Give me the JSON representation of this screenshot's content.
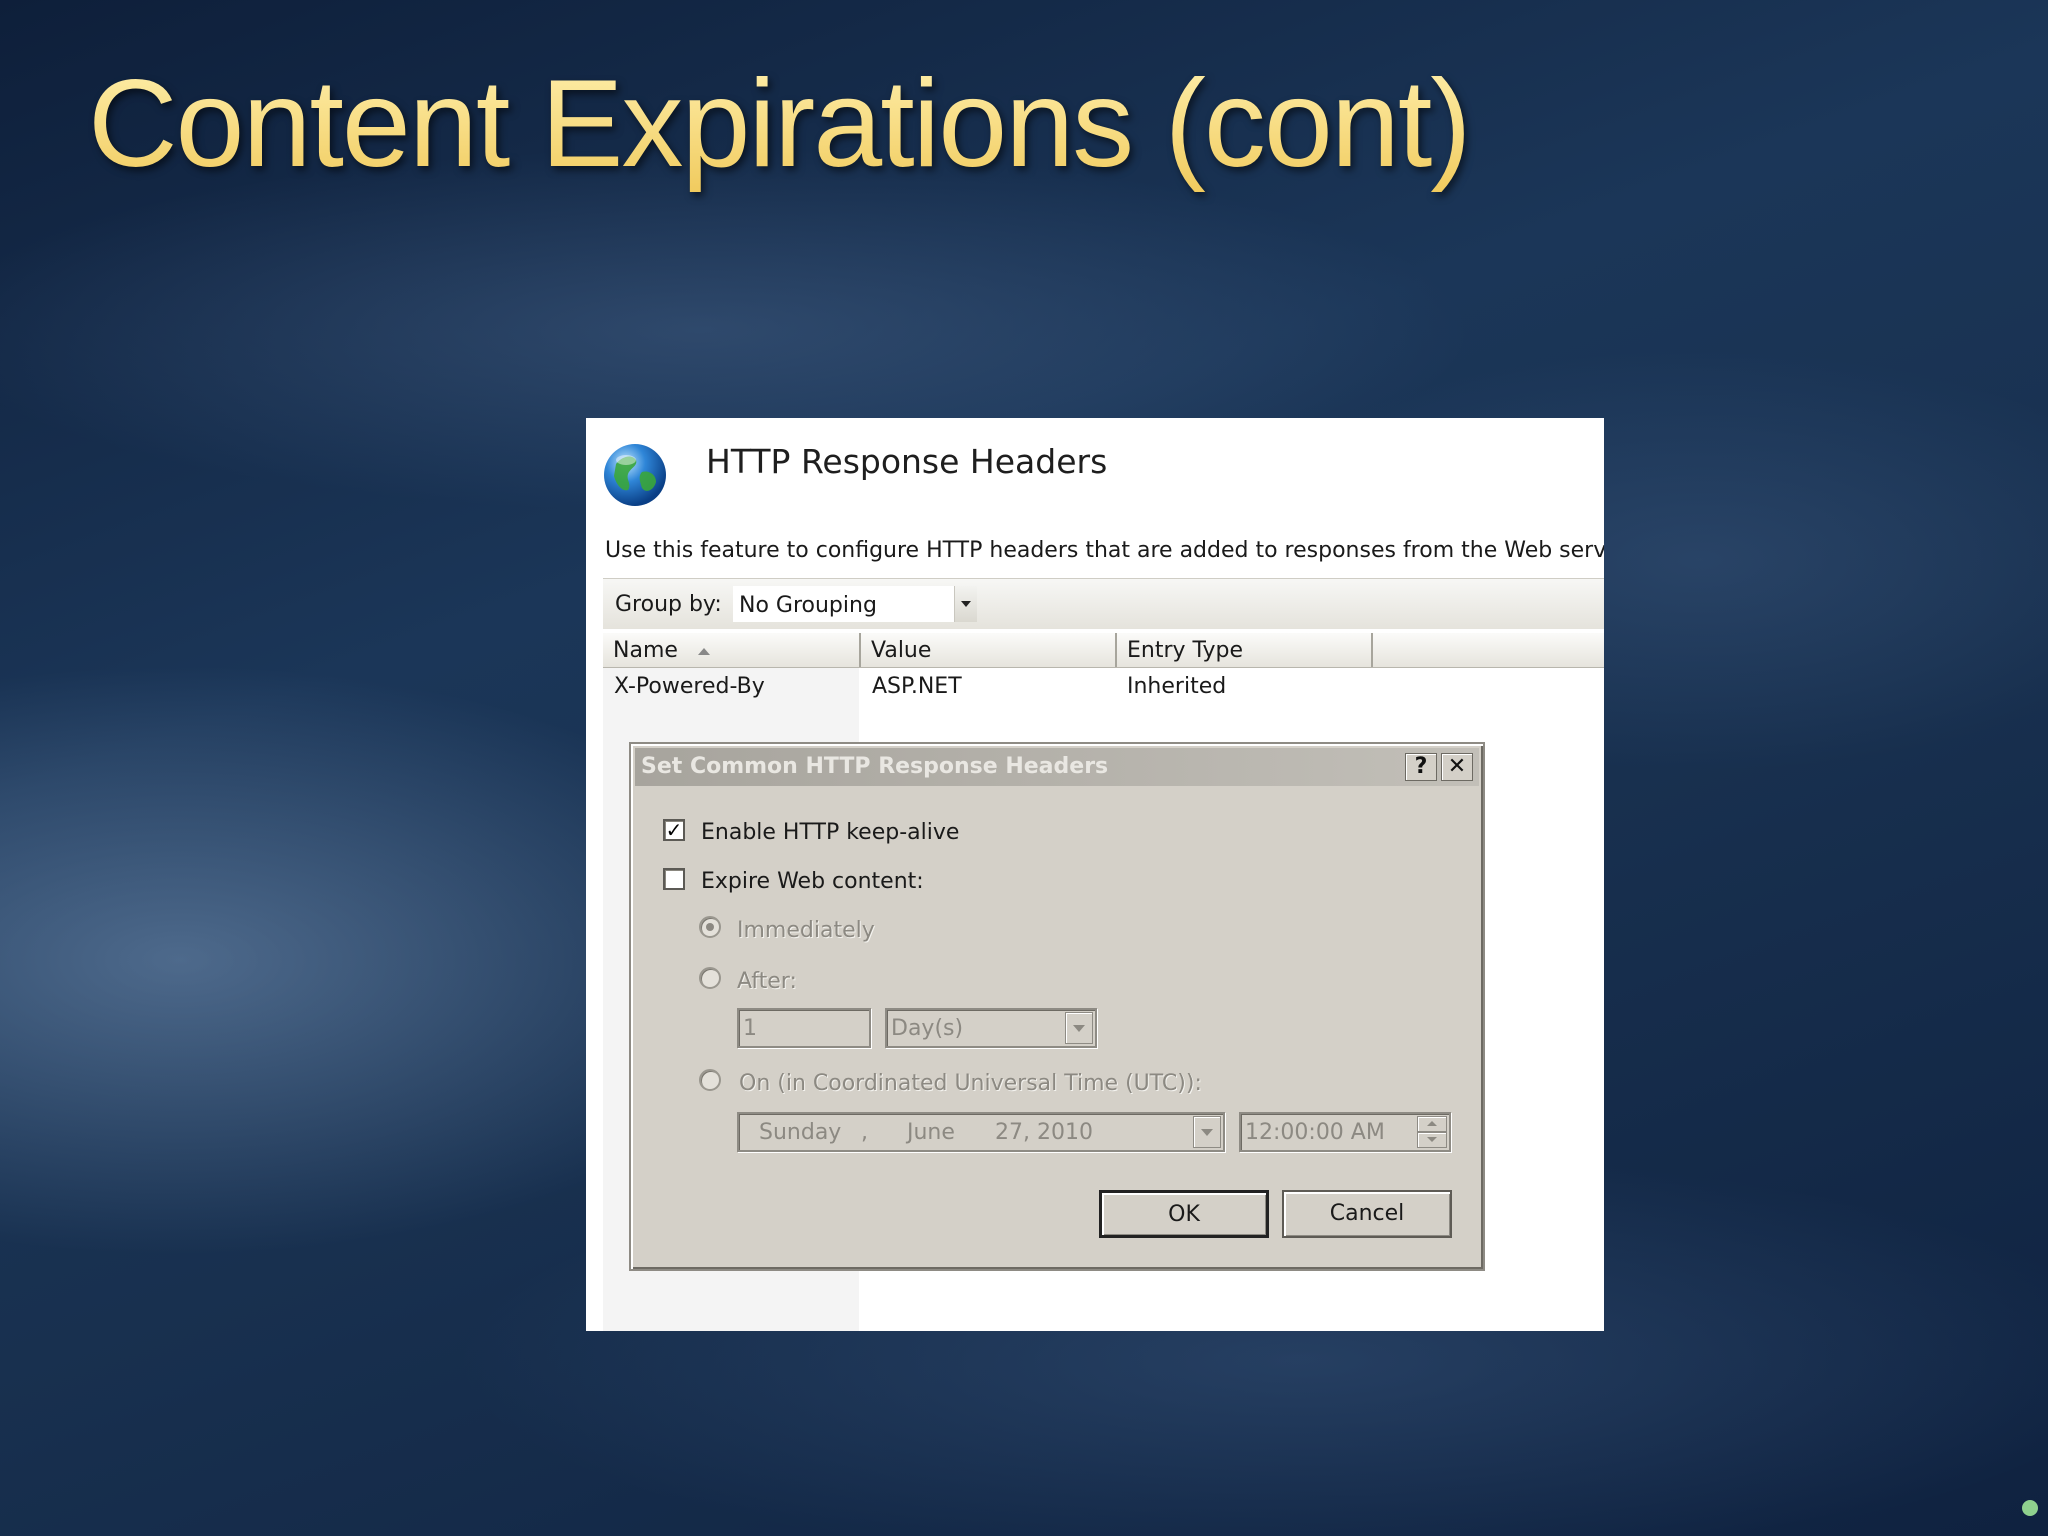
{
  "slide": {
    "title": "Content Expirations (cont)"
  },
  "panel": {
    "title": "HTTP Response Headers",
    "description": "Use this feature to configure HTTP headers that are added to responses from the Web server.",
    "group_by_label": "Group by:",
    "group_by_value": "No Grouping",
    "columns": [
      "Name",
      "Value",
      "Entry Type",
      ""
    ],
    "rows": [
      {
        "name": "X-Powered-By",
        "value": "ASP.NET",
        "entry_type": "Inherited"
      }
    ]
  },
  "dialog": {
    "title": "Set Common HTTP Response Headers",
    "help_button": "?",
    "close_button": "✕",
    "keep_alive_label": "Enable HTTP keep-alive",
    "keep_alive_checked": true,
    "expire_label": "Expire Web content:",
    "expire_checked": false,
    "immediately_label": "Immediately",
    "after_label": "After:",
    "after_value": "1",
    "after_unit": "Day(s)",
    "on_label": "On (in Coordinated Universal Time (UTC)):",
    "date_day": "Sunday",
    "date_sep": ",",
    "date_month": "June",
    "date_rest": "27, 2010",
    "time_value": "12:00:00 AM",
    "ok_label": "OK",
    "cancel_label": "Cancel"
  },
  "colors": {
    "title_gold": "#f3d977",
    "dialog_face": "#d4d0c8",
    "disabled_text": "#8c8982"
  },
  "icons": {
    "globe": "globe-icon",
    "check": "check-icon"
  }
}
